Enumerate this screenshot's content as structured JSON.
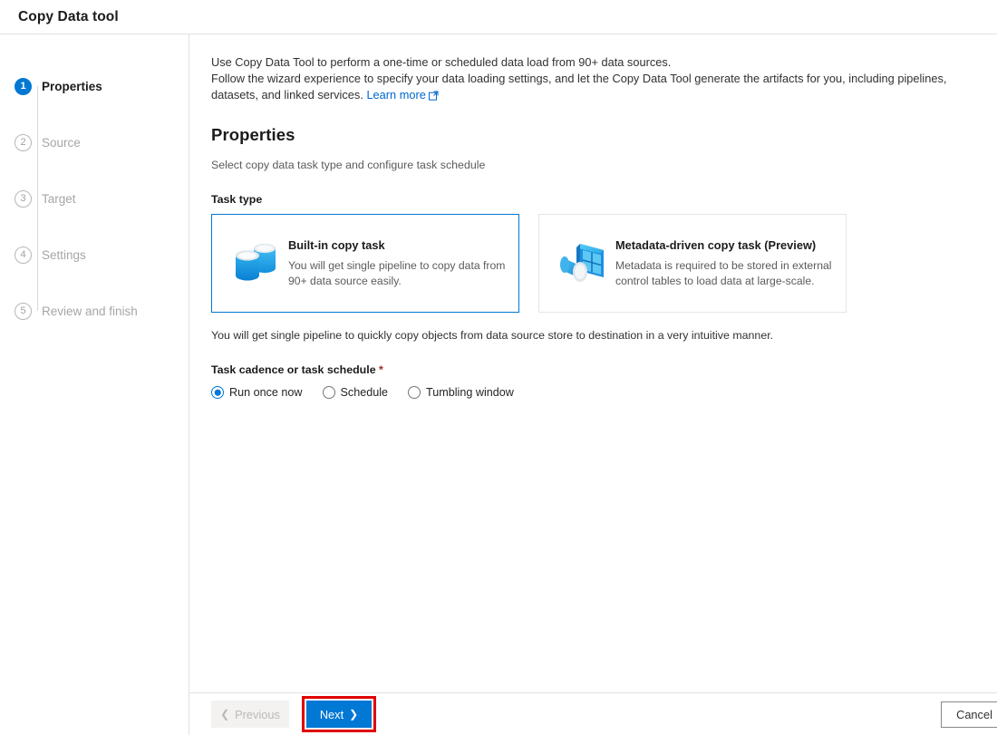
{
  "header": {
    "title": "Copy Data tool"
  },
  "sidebar": {
    "steps": [
      {
        "number": "1",
        "label": "Properties",
        "state": "active"
      },
      {
        "number": "2",
        "label": "Source",
        "state": "inactive"
      },
      {
        "number": "3",
        "label": "Target",
        "state": "inactive"
      },
      {
        "number": "4",
        "label": "Settings",
        "state": "inactive"
      },
      {
        "number": "5",
        "label": "Review and finish",
        "state": "inactive"
      }
    ]
  },
  "main": {
    "intro": {
      "line1": "Use Copy Data Tool to perform a one-time or scheduled data load from 90+ data sources.",
      "line2": "Follow the wizard experience to specify your data loading settings, and let the Copy Data Tool generate the artifacts for you, including pipelines, datasets, and linked services.",
      "link_label": "Learn more",
      "link_icon": "external-link-icon"
    },
    "section_title": "Properties",
    "section_subtitle": "Select copy data task type and configure task schedule",
    "task_type": {
      "label": "Task type",
      "cards": [
        {
          "title": "Built-in copy task",
          "description": "You will get single pipeline to copy data from 90+ data source easily.",
          "icon": "database-cylinders-icon",
          "selected": true
        },
        {
          "title": "Metadata-driven copy task (Preview)",
          "description": "Metadata is required to be stored in external control tables to load data at large-scale.",
          "icon": "metadata-grid-funnel-icon",
          "selected": false
        }
      ]
    },
    "note": "You will get single pipeline to quickly copy objects from data source store to destination in a very intuitive manner.",
    "cadence": {
      "label": "Task cadence or task schedule",
      "required_mark": "*",
      "options": [
        {
          "label": "Run once now",
          "selected": true
        },
        {
          "label": "Schedule",
          "selected": false
        },
        {
          "label": "Tumbling window",
          "selected": false
        }
      ]
    }
  },
  "footer": {
    "previous_label": "Previous",
    "previous_icon": "chevron-left-icon",
    "next_label": "Next",
    "next_icon": "chevron-right-icon",
    "cancel_label": "Cancel"
  },
  "colors": {
    "accent": "#0078d4",
    "annotation": "#e00000",
    "link": "#0066cc",
    "required": "#a4262c",
    "border": "#e1e1e1"
  }
}
